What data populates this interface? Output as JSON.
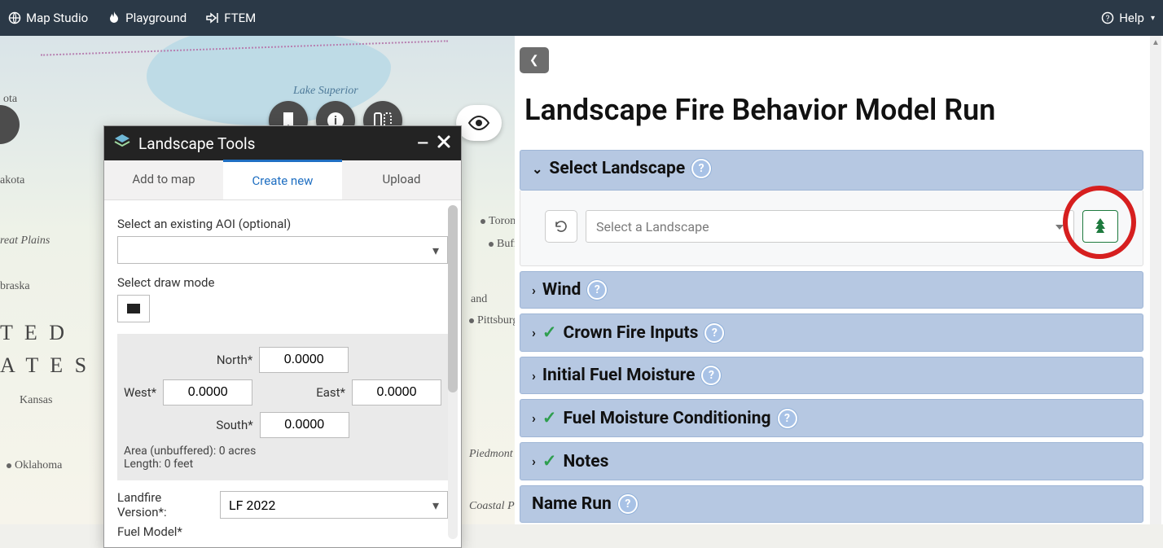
{
  "nav": {
    "map_studio": "Map Studio",
    "playground": "Playground",
    "ftem": "FTEM",
    "help": "Help"
  },
  "map": {
    "labels": {
      "lake_superior": "Lake Superior",
      "ota": "ota",
      "akota": "akota",
      "reat_plains": "reat Plains",
      "braska": "braska",
      "ted": "T E D",
      "ates": "A T E S",
      "kansas": "Kansas",
      "oklahoma": "Oklahoma",
      "toronto": "Toront",
      "buffalo": "Buffa",
      "pittsburgh": "Pittsburgl",
      "piedmont": "Piedmont",
      "coastal": "Coastal Plai",
      "and": "and"
    }
  },
  "tools": {
    "title": "Landscape Tools",
    "tabs": {
      "add": "Add to map",
      "create": "Create new",
      "upload": "Upload"
    },
    "aoi_label": "Select an existing AOI (optional)",
    "draw_label": "Select draw mode",
    "north": "North*",
    "south": "South*",
    "west": "West*",
    "east": "East*",
    "coord_value": "0.0000",
    "area_line": "Area (unbuffered): 0 acres",
    "length_line": "Length: 0 feet",
    "lf_label": "Landfire Version*:",
    "lf_value": "LF 2022",
    "fm_label": "Fuel Model*"
  },
  "right": {
    "title": "Landscape Fire Behavior Model Run",
    "sections": {
      "select_landscape": "Select Landscape",
      "wind": "Wind",
      "crown_fire": "Crown Fire Inputs",
      "initial_fuel": "Initial Fuel Moisture",
      "fuel_cond": "Fuel Moisture Conditioning",
      "notes": "Notes",
      "name_run": "Name Run"
    },
    "landscape_placeholder": "Select a Landscape"
  }
}
